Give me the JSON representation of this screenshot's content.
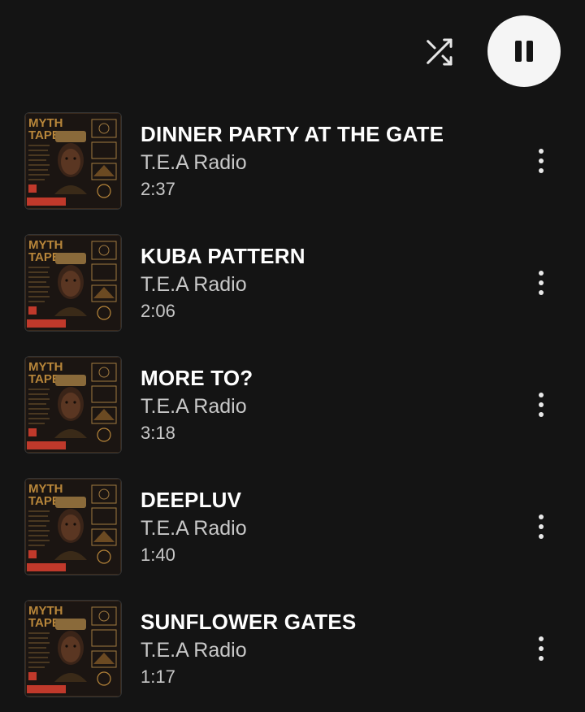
{
  "player": {
    "shuffle_icon": "shuffle-icon",
    "pause_icon": "pause-icon"
  },
  "cover_art": {
    "title_line1": "MYTH",
    "title_line2": "TAPES",
    "accent": "#c0392b",
    "gold": "#b8863a"
  },
  "tracks": [
    {
      "title": "DINNER PARTY AT THE GATE",
      "artist": "T.E.A Radio",
      "duration": "2:37"
    },
    {
      "title": "KUBA PATTERN",
      "artist": "T.E.A Radio",
      "duration": "2:06"
    },
    {
      "title": "MORE TO?",
      "artist": "T.E.A Radio",
      "duration": "3:18"
    },
    {
      "title": "DEEPLUV",
      "artist": "T.E.A Radio",
      "duration": "1:40"
    },
    {
      "title": "SUNFLOWER GATES",
      "artist": "T.E.A Radio",
      "duration": "1:17"
    }
  ],
  "colors": {
    "background": "#141414",
    "title_text": "#ffffff",
    "secondary_text": "#c8c8c8",
    "pause_button_bg": "#f5f5f5"
  }
}
